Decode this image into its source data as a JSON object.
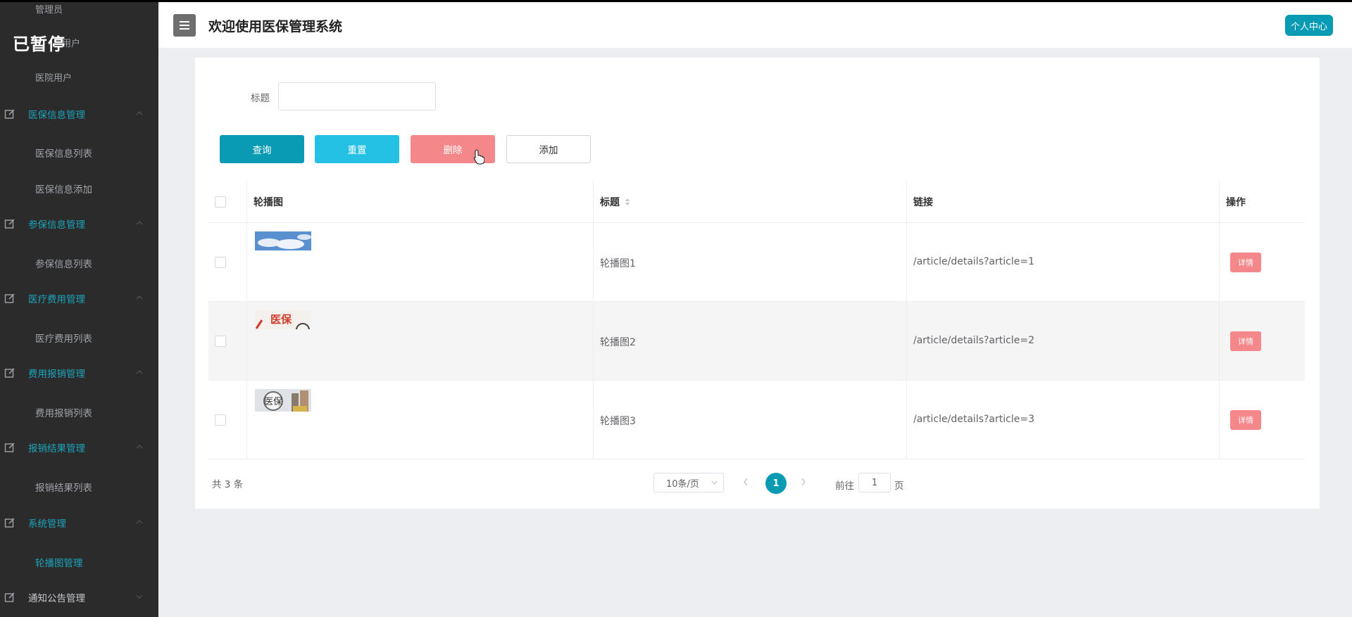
{
  "overlay": {
    "paused_text": "已暂停"
  },
  "sidebar": {
    "top_items": [
      "管理员",
      "用户",
      "医院用户"
    ],
    "groups": [
      {
        "label": "医保信息管理",
        "children": [
          "医保信息列表",
          "医保信息添加"
        ],
        "expanded": true
      },
      {
        "label": "参保信息管理",
        "children": [
          "参保信息列表"
        ],
        "expanded": true
      },
      {
        "label": "医疗费用管理",
        "children": [
          "医疗费用列表"
        ],
        "expanded": true
      },
      {
        "label": "费用报销管理",
        "children": [
          "费用报销列表"
        ],
        "expanded": true
      },
      {
        "label": "报销结果管理",
        "children": [
          "报销结果列表"
        ],
        "expanded": true
      },
      {
        "label": "系统管理",
        "children": [
          "轮播图管理"
        ],
        "expanded": true,
        "active_child": "轮播图管理"
      },
      {
        "label": "通知公告管理",
        "children": [],
        "expanded": false
      }
    ]
  },
  "header": {
    "title": "欢迎使用医保管理系统",
    "profile_button": "个人中心"
  },
  "search": {
    "label": "标题",
    "value": ""
  },
  "buttons": {
    "query": "查询",
    "reset": "重置",
    "delete": "删除",
    "add": "添加"
  },
  "table": {
    "columns": {
      "image": "轮播图",
      "title": "标题",
      "link": "链接",
      "action": "操作"
    },
    "rows": [
      {
        "title": "轮播图1",
        "link": "/article/details?article=1",
        "action": "详情",
        "image_alt": ""
      },
      {
        "title": "轮播图2",
        "link": "/article/details?article=2",
        "action": "详情",
        "image_alt": "医保"
      },
      {
        "title": "轮播图3",
        "link": "/article/details?article=3",
        "action": "详情",
        "image_alt": "医保"
      }
    ]
  },
  "pagination": {
    "total_text": "共 3 条",
    "page_size": "10条/页",
    "current_page": "1",
    "goto_label": "前往",
    "goto_value": "1",
    "goto_unit": "页"
  },
  "colors": {
    "accent": "#0a9bb4",
    "reset": "#25c1e4",
    "danger": "#f4878a",
    "sidebar_bg": "#2b2b2c"
  }
}
